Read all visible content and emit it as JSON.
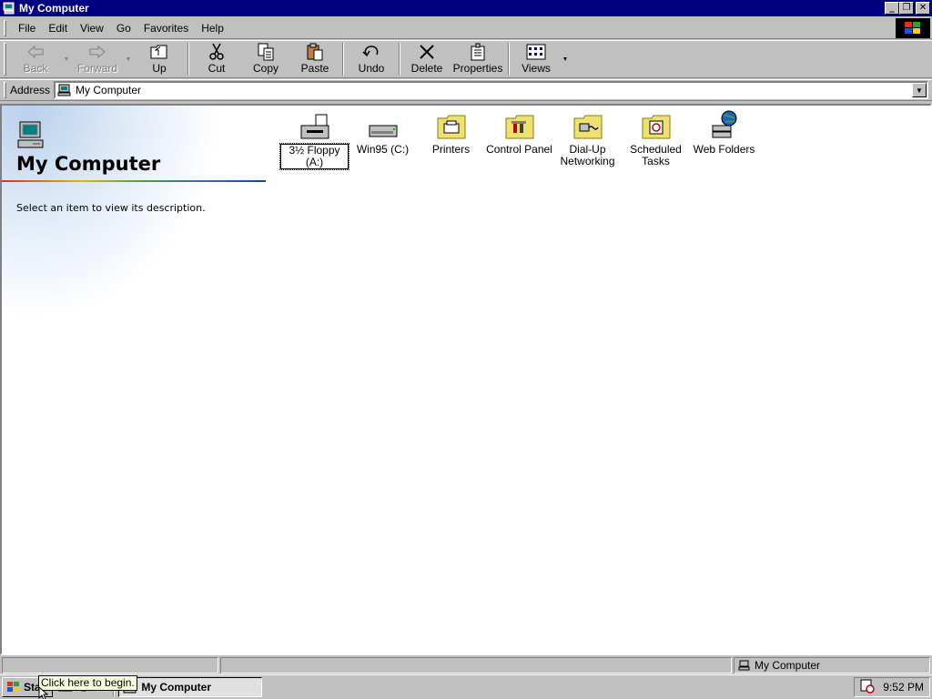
{
  "window": {
    "title": "My Computer"
  },
  "menubar": {
    "items": [
      {
        "label": "File"
      },
      {
        "label": "Edit"
      },
      {
        "label": "View"
      },
      {
        "label": "Go"
      },
      {
        "label": "Favorites"
      },
      {
        "label": "Help"
      }
    ]
  },
  "toolbar": {
    "back": "Back",
    "forward": "Forward",
    "up": "Up",
    "cut": "Cut",
    "copy": "Copy",
    "paste": "Paste",
    "undo": "Undo",
    "delete": "Delete",
    "properties": "Properties",
    "views": "Views"
  },
  "address": {
    "label": "Address",
    "value": "My Computer"
  },
  "webview": {
    "title": "My Computer",
    "description": "Select an item to view its description."
  },
  "icons": [
    {
      "label": "3½ Floppy (A:)",
      "selected": true
    },
    {
      "label": "Win95 (C:)"
    },
    {
      "label": "Printers"
    },
    {
      "label": "Control Panel"
    },
    {
      "label": "Dial-Up Networking"
    },
    {
      "label": "Scheduled Tasks"
    },
    {
      "label": "Web Folders"
    }
  ],
  "statusbar": {
    "location": "My Computer"
  },
  "taskbar": {
    "start": "Start",
    "task": "My Computer",
    "clock": "9:52 PM",
    "tooltip": "Click here to begin."
  },
  "colors": {
    "titlebar": "#000080",
    "face": "#c0c0c0",
    "tooltip": "#ffffe1"
  }
}
